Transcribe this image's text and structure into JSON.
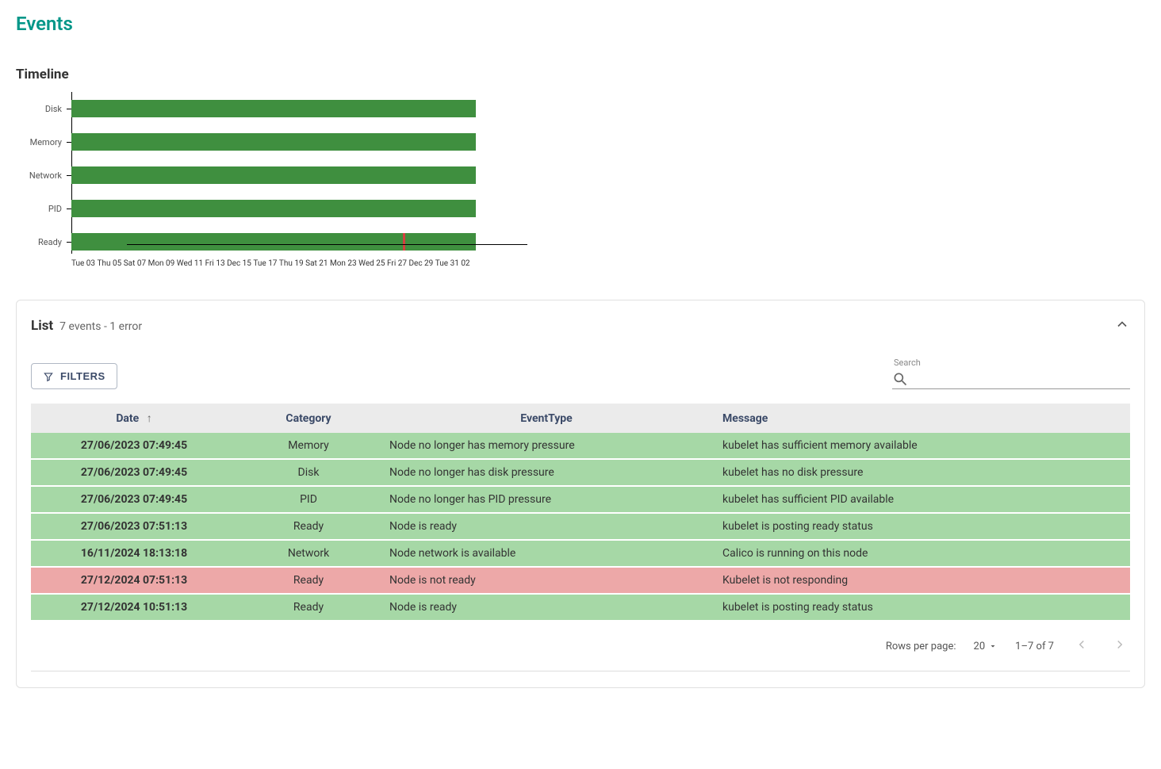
{
  "page_title": "Events",
  "timeline": {
    "title": "Timeline",
    "categories": [
      "Disk",
      "Memory",
      "Network",
      "PID",
      "Ready"
    ],
    "x_ticks": [
      "Tue 03",
      "Thu 05",
      "Sat 07",
      "Mon 09",
      "Wed 11",
      "Fri 13",
      "Dec 15",
      "Tue 17",
      "Thu 19",
      "Sat 21",
      "Mon 23",
      "Wed 25",
      "Fri 27",
      "Dec 29",
      "Tue 31",
      "02"
    ],
    "ready_marker_percent": 82
  },
  "chart_data": {
    "type": "bar",
    "orientation": "horizontal",
    "title": "Timeline",
    "categories": [
      "Disk",
      "Memory",
      "Network",
      "PID",
      "Ready"
    ],
    "x_range": [
      "2024-12-03",
      "2025-01-02"
    ],
    "x_ticks": [
      "Tue 03",
      "Thu 05",
      "Sat 07",
      "Mon 09",
      "Wed 11",
      "Fri 13",
      "Dec 15",
      "Tue 17",
      "Thu 19",
      "Sat 21",
      "Mon 23",
      "Wed 25",
      "Fri 27",
      "Dec 29",
      "Tue 31",
      "02"
    ],
    "series": [
      {
        "name": "Disk",
        "segments": [
          {
            "start": "2024-12-03",
            "end": "2025-01-02",
            "status": "ok"
          }
        ]
      },
      {
        "name": "Memory",
        "segments": [
          {
            "start": "2024-12-03",
            "end": "2025-01-02",
            "status": "ok"
          }
        ]
      },
      {
        "name": "Network",
        "segments": [
          {
            "start": "2024-12-03",
            "end": "2025-01-02",
            "status": "ok"
          }
        ]
      },
      {
        "name": "PID",
        "segments": [
          {
            "start": "2024-12-03",
            "end": "2025-01-02",
            "status": "ok"
          }
        ]
      },
      {
        "name": "Ready",
        "segments": [
          {
            "start": "2024-12-03",
            "end": "2025-01-02",
            "status": "ok"
          }
        ],
        "markers": [
          {
            "date": "2024-12-27",
            "status": "error"
          }
        ]
      }
    ],
    "colors": {
      "ok": "#3f8f3f",
      "error": "#d34040"
    }
  },
  "list": {
    "title": "List",
    "summary": "7 events - 1 error",
    "filters_label": "FILTERS",
    "search_label": "Search",
    "search_placeholder": "",
    "columns": {
      "date": "Date",
      "category": "Category",
      "event_type": "EventType",
      "message": "Message"
    },
    "rows": [
      {
        "date": "27/06/2023 07:49:45",
        "category": "Memory",
        "event_type": "Node no longer has memory pressure",
        "message": "kubelet has sufficient memory available",
        "status": "ok"
      },
      {
        "date": "27/06/2023 07:49:45",
        "category": "Disk",
        "event_type": "Node no longer has disk pressure",
        "message": "kubelet has no disk pressure",
        "status": "ok"
      },
      {
        "date": "27/06/2023 07:49:45",
        "category": "PID",
        "event_type": "Node no longer has PID pressure",
        "message": "kubelet has sufficient PID available",
        "status": "ok"
      },
      {
        "date": "27/06/2023 07:51:13",
        "category": "Ready",
        "event_type": "Node is ready",
        "message": "kubelet is posting ready status",
        "status": "ok"
      },
      {
        "date": "16/11/2024 18:13:18",
        "category": "Network",
        "event_type": "Node network is available",
        "message": "Calico is running on this node",
        "status": "ok"
      },
      {
        "date": "27/12/2024 07:51:13",
        "category": "Ready",
        "event_type": "Node is not ready",
        "message": "Kubelet is not responding",
        "status": "err"
      },
      {
        "date": "27/12/2024 10:51:13",
        "category": "Ready",
        "event_type": "Node is ready",
        "message": "kubelet is posting ready status",
        "status": "ok"
      }
    ],
    "pager": {
      "rows_label": "Rows per page:",
      "rows_value": "20",
      "range": "1–7 of 7"
    }
  }
}
